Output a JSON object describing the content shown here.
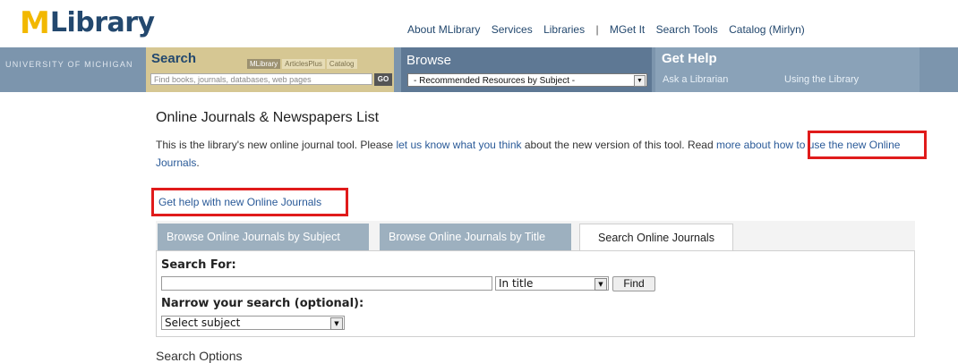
{
  "logo": {
    "m": "M",
    "rest": "Library"
  },
  "top_links": [
    "About MLibrary",
    "Services",
    "Libraries",
    "|",
    "MGet It",
    "Search Tools",
    "Catalog (Mirlyn)"
  ],
  "bar": {
    "umich": "UNIVERSITY OF MICHIGAN",
    "search_title": "Search",
    "search_tabs": [
      "MLibrary",
      "ArticlesPlus",
      "Catalog"
    ],
    "search_placeholder": "Find books, journals, databases, web pages",
    "go_label": "GO",
    "browse_title": "Browse",
    "browse_select": "- Recommended Resources by Subject -",
    "help_title": "Get Help",
    "help_links": [
      "Ask a Librarian",
      "Using the Library"
    ]
  },
  "page": {
    "title": "Online Journals & Newspapers List",
    "intro_a": "This is the library's new online journal tool. Please ",
    "intro_link1": "let us know what you think",
    "intro_b": " about the new version of this tool. Read ",
    "intro_link2": "more about how to use the new Online Journals",
    "intro_c": ".",
    "help_link": "Get help with new Online Journals"
  },
  "tabs": [
    "Browse Online Journals by Subject",
    "Browse Online Journals by Title",
    "Search Online Journals"
  ],
  "form": {
    "search_for_label": "Search For:",
    "search_value": "",
    "scope_select": "In title",
    "find_label": "Find",
    "narrow_label": "Narrow your search (optional):",
    "subject_select": "Select subject"
  },
  "cut_text": "Search Options",
  "colors": {
    "accent": "#e01b1b",
    "link": "#2a5a98",
    "navy": "#23486e",
    "maize": "#f2b800"
  }
}
